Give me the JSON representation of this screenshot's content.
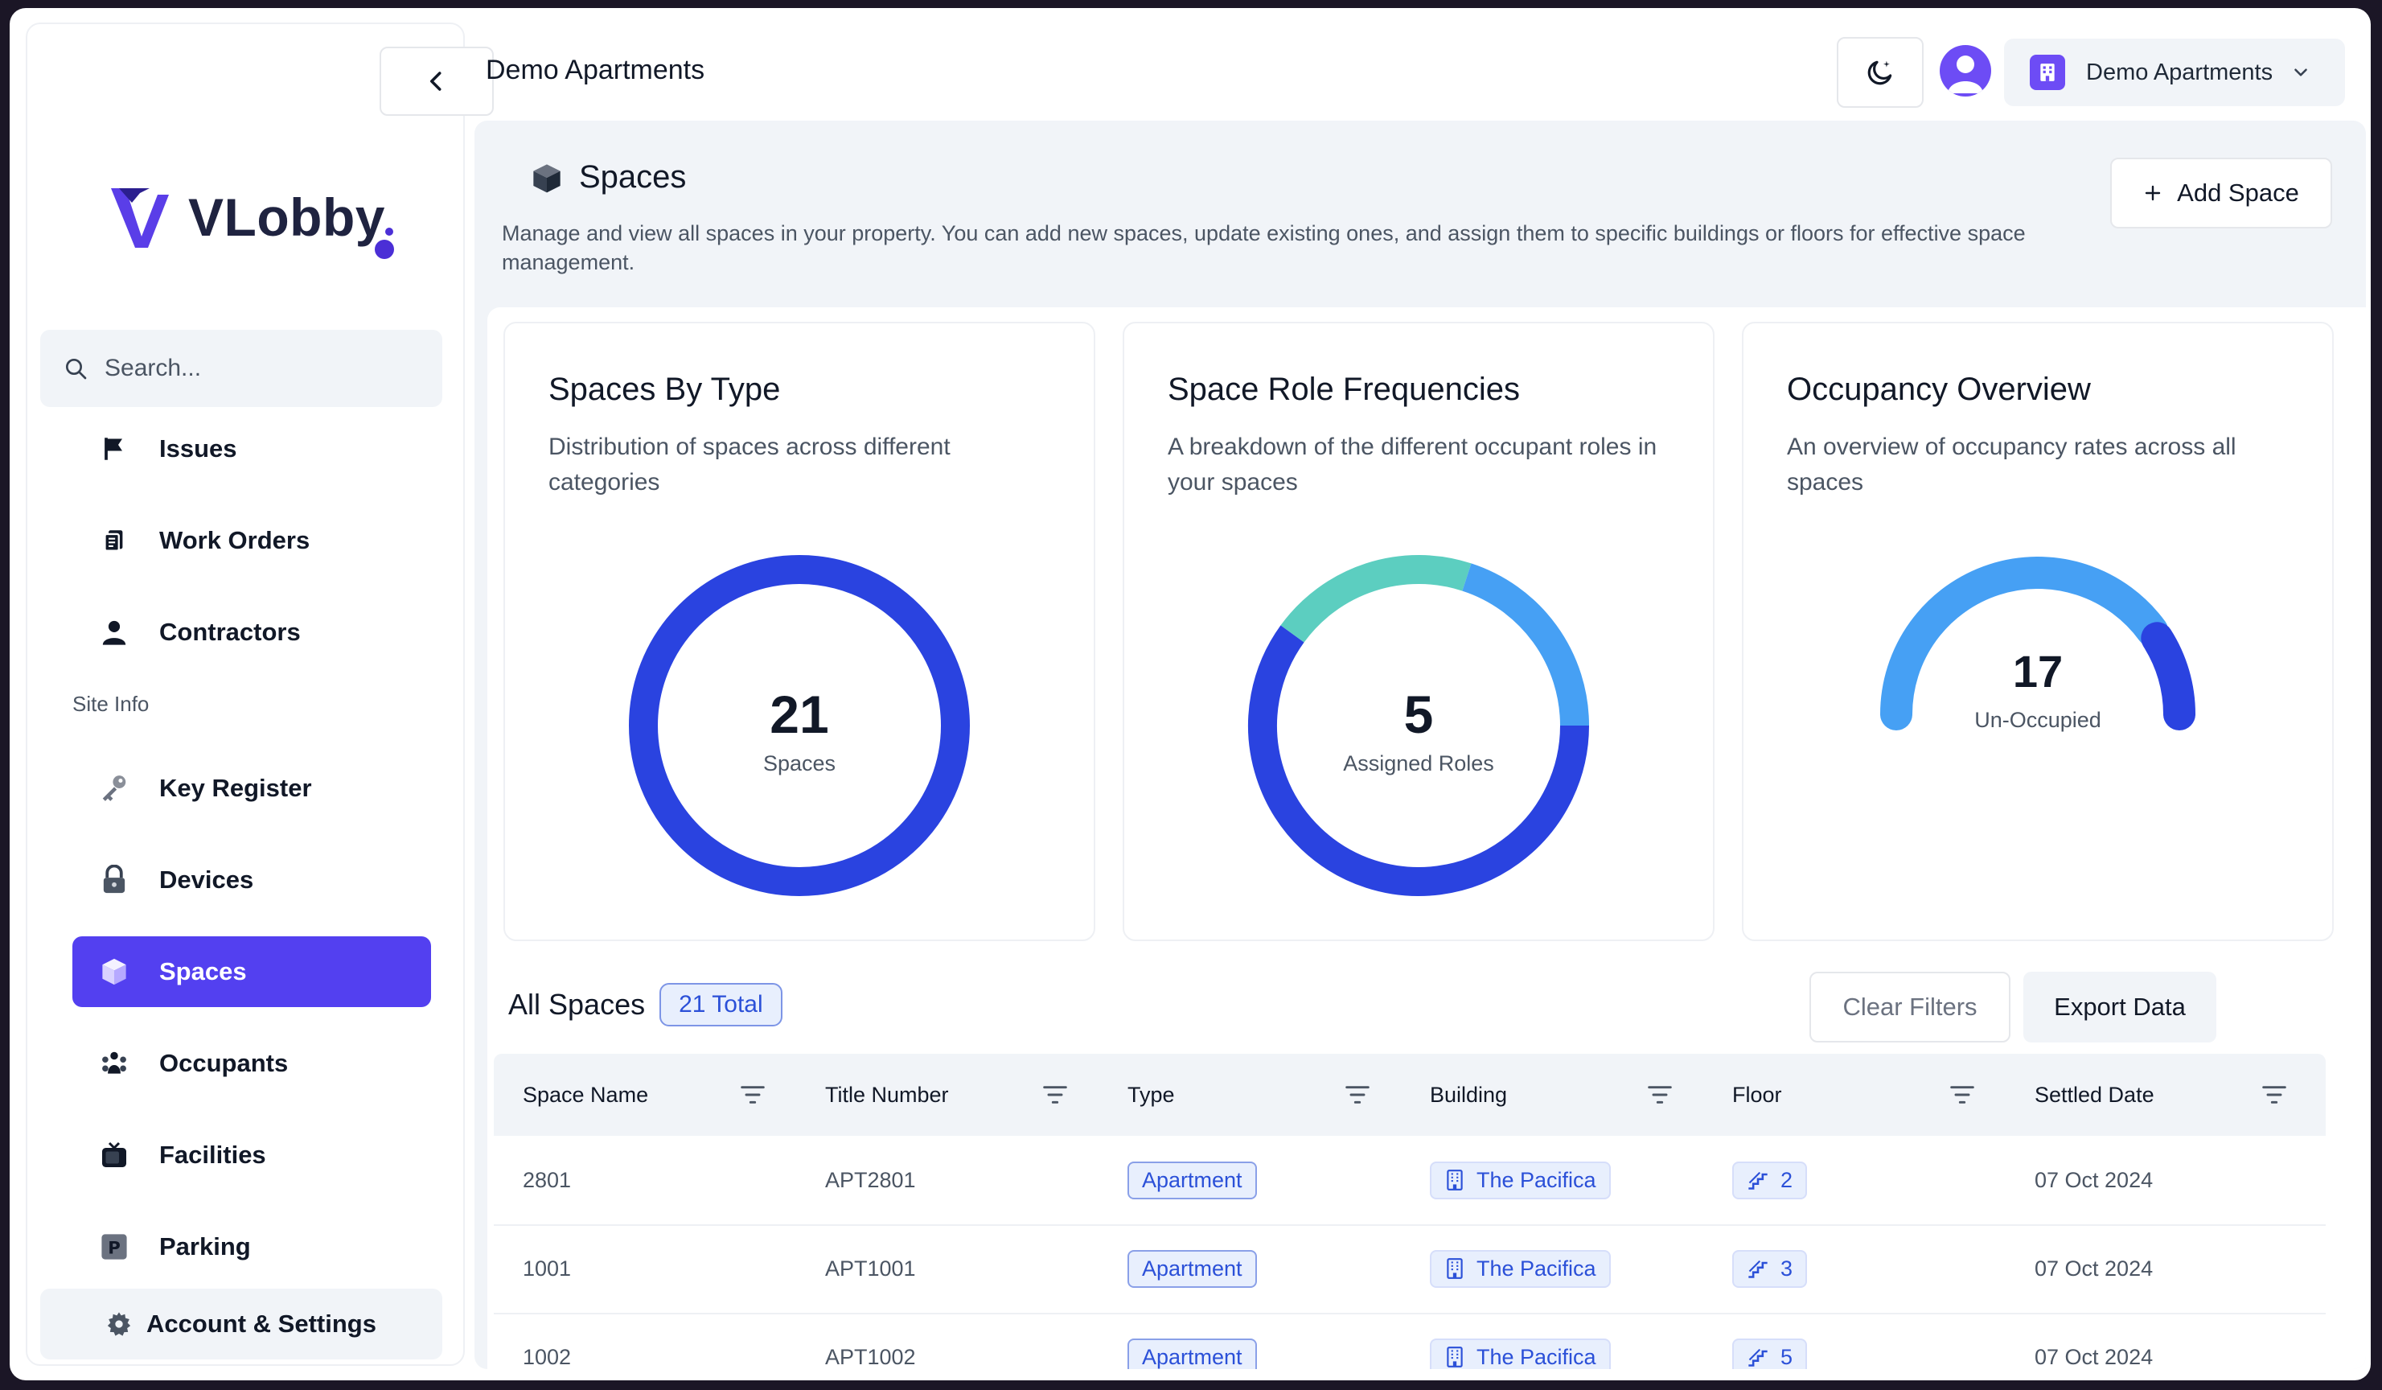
{
  "app": {
    "logo_text": "VLobby",
    "header_title": "Demo Apartments",
    "property_selector": "Demo Apartments"
  },
  "sidebar": {
    "search_placeholder": "Search...",
    "items": [
      {
        "label": "Issues",
        "icon": "flag-icon"
      },
      {
        "label": "Work Orders",
        "icon": "clipboard-icon"
      },
      {
        "label": "Contractors",
        "icon": "person-icon"
      }
    ],
    "section_label": "Site Info",
    "site_items": [
      {
        "label": "Key Register",
        "icon": "key-icon"
      },
      {
        "label": "Devices",
        "icon": "lock-icon"
      },
      {
        "label": "Spaces",
        "icon": "cube-icon",
        "active": true
      },
      {
        "label": "Occupants",
        "icon": "group-icon"
      },
      {
        "label": "Facilities",
        "icon": "tv-icon"
      },
      {
        "label": "Parking",
        "icon": "parking-icon"
      }
    ],
    "account_label": "Account & Settings"
  },
  "page": {
    "title": "Spaces",
    "description": "Manage and view all spaces in your property. You can add new spaces, update existing ones, and assign them to specific buildings or floors for effective space management.",
    "add_button": "Add Space"
  },
  "cards": [
    {
      "title": "Spaces By Type",
      "description": "Distribution of spaces across different categories",
      "value": "21",
      "caption": "Spaces"
    },
    {
      "title": "Space Role Frequencies",
      "description": "A breakdown of the different occupant roles in your spaces",
      "value": "5",
      "caption": "Assigned Roles"
    },
    {
      "title": "Occupancy Overview",
      "description": "An overview of occupancy rates across all spaces",
      "value": "17",
      "caption": "Un-Occupied"
    }
  ],
  "chart_data": [
    {
      "type": "pie",
      "title": "Spaces By Type",
      "values": [
        21
      ],
      "colors": [
        "#2a43e0"
      ]
    },
    {
      "type": "pie",
      "title": "Space Role Frequencies",
      "values": [
        3,
        1,
        1
      ],
      "colors": [
        "#2a43e0",
        "#5ccec0",
        "#46a0f4"
      ]
    },
    {
      "type": "pie",
      "title": "Occupancy Overview",
      "values": [
        17,
        4
      ],
      "colors": [
        "#46a0f4",
        "#2a43e0"
      ]
    }
  ],
  "table": {
    "title": "All Spaces",
    "total_badge": "21 Total",
    "clear_filters": "Clear Filters",
    "export": "Export Data",
    "columns": [
      "Space Name",
      "Title Number",
      "Type",
      "Building",
      "Floor",
      "Settled Date"
    ],
    "rows": [
      {
        "name": "2801",
        "title_number": "APT2801",
        "type": "Apartment",
        "building": "The Pacifica",
        "floor": "2",
        "settled": "07 Oct 2024"
      },
      {
        "name": "1001",
        "title_number": "APT1001",
        "type": "Apartment",
        "building": "The Pacifica",
        "floor": "3",
        "settled": "07 Oct 2024"
      },
      {
        "name": "1002",
        "title_number": "APT1002",
        "type": "Apartment",
        "building": "The Pacifica",
        "floor": "5",
        "settled": "07 Oct 2024"
      }
    ]
  }
}
